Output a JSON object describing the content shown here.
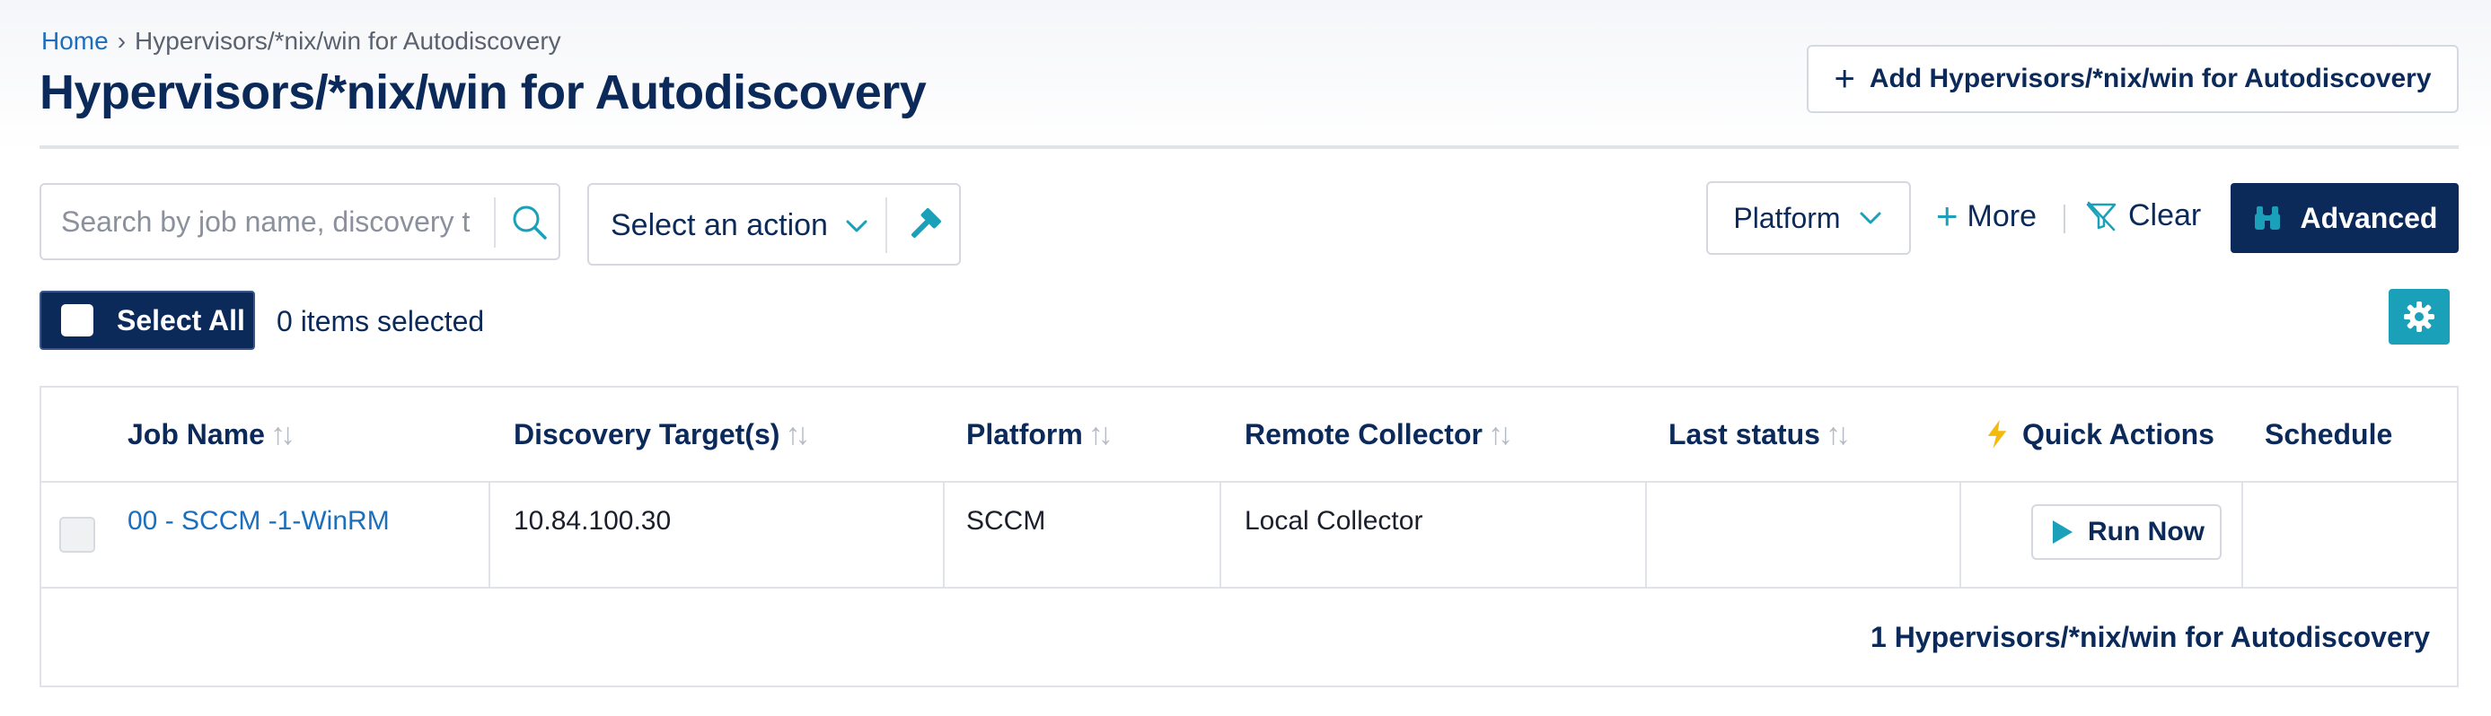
{
  "breadcrumb": {
    "home": "Home",
    "separator": "›",
    "current": "Hypervisors/*nix/win for Autodiscovery"
  },
  "page_title": "Hypervisors/*nix/win for Autodiscovery",
  "add_button_label": "Add Hypervisors/*nix/win for Autodiscovery",
  "search": {
    "placeholder": "Search by job name, discovery t",
    "value": ""
  },
  "action_select": {
    "label": "Select an action"
  },
  "filters": {
    "platform_label": "Platform",
    "more_label": "More",
    "clear_label": "Clear",
    "advanced_label": "Advanced"
  },
  "selection": {
    "select_all_label": "Select All",
    "items_selected": "0 items selected"
  },
  "table": {
    "columns": {
      "job_name": "Job Name",
      "discovery_targets": "Discovery Target(s)",
      "platform": "Platform",
      "remote_collector": "Remote Collector",
      "last_status": "Last status",
      "quick_actions": "Quick Actions",
      "schedule": "Schedule"
    },
    "rows": [
      {
        "job_name": "00 - SCCM -1-WinRM",
        "discovery_targets": "10.84.100.30",
        "platform": "SCCM",
        "remote_collector": "Local Collector",
        "last_status": "",
        "quick_action": "Run Now",
        "schedule": ""
      }
    ],
    "footer": "1 Hypervisors/*nix/win for Autodiscovery"
  },
  "colors": {
    "navy": "#0b2a5a",
    "link": "#1b6fbd",
    "teal": "#1aa0b8",
    "bolt": "#f2b90f"
  },
  "icons": [
    "plus-icon",
    "search-icon",
    "chevron-down-icon",
    "gavel-icon",
    "filter-clear-icon",
    "binoculars-icon",
    "gear-icon",
    "sort-icon",
    "bolt-icon",
    "play-icon"
  ]
}
